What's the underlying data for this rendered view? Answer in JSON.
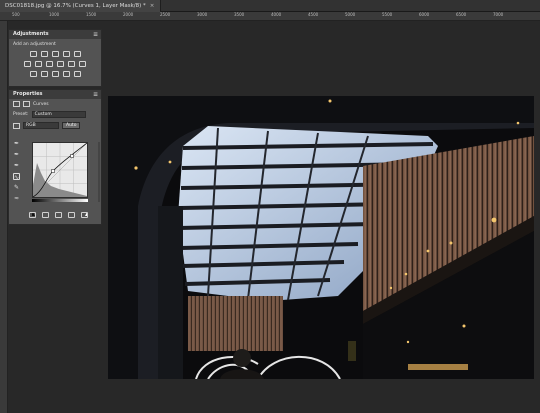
{
  "document": {
    "tab_title": "DSC01818.jpg @ 16.7% (Curves 1, Layer Mask/8) *",
    "close_glyph": "×"
  },
  "rulers": {
    "top_ticks": [
      "500",
      "1000",
      "1500",
      "2000",
      "2500",
      "3000",
      "3500",
      "4000",
      "4500",
      "5000",
      "5500",
      "6000",
      "6500",
      "7000"
    ]
  },
  "adjustments_panel": {
    "title": "Adjustments",
    "subtitle": "Add an adjustment",
    "icons_row1": [
      "brightness-contrast-icon",
      "levels-icon",
      "curves-icon",
      "exposure-icon",
      "vibrance-icon"
    ],
    "icons_row2": [
      "hue-saturation-icon",
      "color-balance-icon",
      "black-white-icon",
      "photo-filter-icon",
      "channel-mixer-icon",
      "color-lookup-icon"
    ],
    "icons_row3": [
      "invert-icon",
      "posterize-icon",
      "threshold-icon",
      "gradient-map-icon",
      "selective-color-icon"
    ]
  },
  "properties_panel": {
    "title": "Properties",
    "layer_label": "Curves",
    "preset_label": "Preset:",
    "preset_value": "Custom",
    "channel_value": "RGB",
    "auto_label": "Auto"
  },
  "colors": {
    "app_bg": "#282828",
    "panel_bg": "#535353",
    "panel_header": "#3c3c3c"
  }
}
